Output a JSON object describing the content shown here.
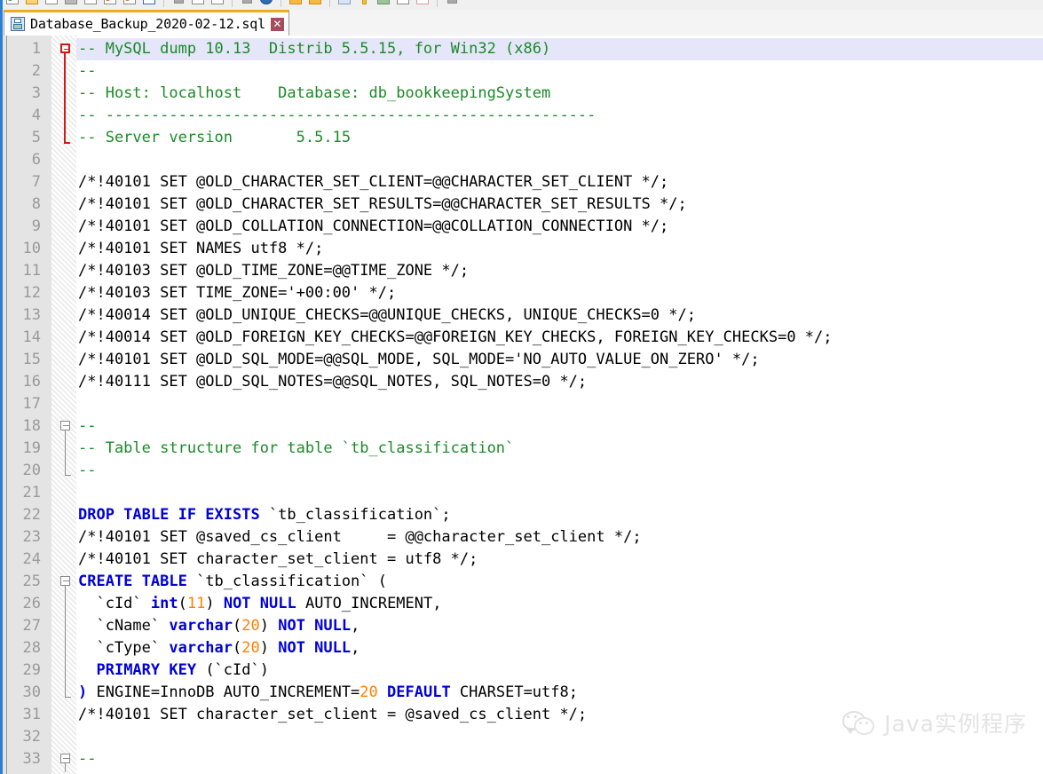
{
  "window": {
    "accent_orange": "#f5a623",
    "frame_blue": "#2a7fd4"
  },
  "toolbar": {
    "name": "main-toolbar",
    "note": "toolbar icon row is clipped at the top edge of the screenshot",
    "buttons": [
      {
        "name": "new-file-icon",
        "kind": "green"
      },
      {
        "name": "open-folder-icon",
        "kind": "folder-open"
      },
      {
        "name": "save-icon",
        "kind": "plain"
      },
      {
        "name": "save-all-icon",
        "kind": "gray"
      },
      {
        "name": "close-file-icon",
        "kind": "plain"
      },
      {
        "name": "close-all-icon",
        "kind": "red"
      },
      {
        "name": "print-icon",
        "kind": "orange"
      },
      {
        "name": "print-now-icon",
        "kind": "blue-sel"
      },
      {
        "sep": true
      },
      {
        "name": "cut-icon",
        "kind": "gray-sm"
      },
      {
        "name": "copy-icon",
        "kind": "plain"
      },
      {
        "name": "paste-icon",
        "kind": "plain"
      },
      {
        "sep": true
      },
      {
        "name": "undo-icon",
        "kind": "gray-sm"
      },
      {
        "name": "redo-icon",
        "kind": "globe"
      },
      {
        "sep": true
      },
      {
        "name": "find-icon",
        "kind": "folder"
      },
      {
        "name": "replace-icon",
        "kind": "folder"
      },
      {
        "sep": true
      },
      {
        "name": "zoom-in-icon",
        "kind": "lightblue"
      },
      {
        "name": "zoom-out-icon",
        "kind": "yellowbar"
      },
      {
        "name": "sync-scroll-icon",
        "kind": "greenfill"
      },
      {
        "name": "word-wrap-icon",
        "kind": "plain"
      },
      {
        "name": "show-symbol-icon",
        "kind": "pink"
      },
      {
        "sep": true
      },
      {
        "name": "macro-record-icon",
        "kind": "gray-sm"
      }
    ]
  },
  "tabbar": {
    "active_tab": {
      "label": "Database_Backup_2020-02-12.sql",
      "icon": "floppy-disk-icon",
      "close_label": "✕",
      "modified": false
    }
  },
  "editor": {
    "language": "SQL",
    "current_line": 1,
    "first_visible_line": 1,
    "last_visible_line": 33,
    "colors": {
      "comment": "#1a8a28",
      "keyword": "#0000d8",
      "number": "#ff8000",
      "plain": "#000000",
      "current_line_bg": "#e6e6fa",
      "gutter_bg": "#e4e4e4",
      "line_number": "#9a9a9a"
    },
    "fold_markers": [
      {
        "line": 1,
        "state": "open",
        "color": "#d31616",
        "span_lines": 5
      },
      {
        "line": 18,
        "state": "open",
        "color": "#8a8a8a",
        "span_lines": 3
      },
      {
        "line": 25,
        "state": "open",
        "color": "#8a8a8a",
        "span_lines": 6
      },
      {
        "line": 33,
        "state": "open",
        "color": "#8a8a8a",
        "span_lines": 1
      }
    ],
    "lines": [
      {
        "n": 1,
        "tokens": [
          {
            "t": "-- MySQL dump 10.13  Distrib 5.5.15, for Win32 (x86)",
            "c": "cm"
          }
        ]
      },
      {
        "n": 2,
        "tokens": [
          {
            "t": "--",
            "c": "cm"
          }
        ]
      },
      {
        "n": 3,
        "tokens": [
          {
            "t": "-- Host: localhost    Database: db_bookkeepingSystem",
            "c": "cm"
          }
        ]
      },
      {
        "n": 4,
        "tokens": [
          {
            "t": "-- ------------------------------------------------------",
            "c": "cm"
          }
        ]
      },
      {
        "n": 5,
        "tokens": [
          {
            "t": "-- Server version\t5.5.15",
            "c": "cm"
          }
        ]
      },
      {
        "n": 6,
        "tokens": []
      },
      {
        "n": 7,
        "tokens": [
          {
            "t": "/*!40101 SET @OLD_CHARACTER_SET_CLIENT=@@CHARACTER_SET_CLIENT */;",
            "c": "pl"
          }
        ]
      },
      {
        "n": 8,
        "tokens": [
          {
            "t": "/*!40101 SET @OLD_CHARACTER_SET_RESULTS=@@CHARACTER_SET_RESULTS */;",
            "c": "pl"
          }
        ]
      },
      {
        "n": 9,
        "tokens": [
          {
            "t": "/*!40101 SET @OLD_COLLATION_CONNECTION=@@COLLATION_CONNECTION */;",
            "c": "pl"
          }
        ]
      },
      {
        "n": 10,
        "tokens": [
          {
            "t": "/*!40101 SET NAMES utf8 */;",
            "c": "pl"
          }
        ]
      },
      {
        "n": 11,
        "tokens": [
          {
            "t": "/*!40103 SET @OLD_TIME_ZONE=@@TIME_ZONE */;",
            "c": "pl"
          }
        ]
      },
      {
        "n": 12,
        "tokens": [
          {
            "t": "/*!40103 SET TIME_ZONE='+00:00' */;",
            "c": "pl"
          }
        ]
      },
      {
        "n": 13,
        "tokens": [
          {
            "t": "/*!40014 SET @OLD_UNIQUE_CHECKS=@@UNIQUE_CHECKS, UNIQUE_CHECKS=0 */;",
            "c": "pl"
          }
        ]
      },
      {
        "n": 14,
        "tokens": [
          {
            "t": "/*!40014 SET @OLD_FOREIGN_KEY_CHECKS=@@FOREIGN_KEY_CHECKS, FOREIGN_KEY_CHECKS=0 */;",
            "c": "pl"
          }
        ]
      },
      {
        "n": 15,
        "tokens": [
          {
            "t": "/*!40101 SET @OLD_SQL_MODE=@@SQL_MODE, SQL_MODE='NO_AUTO_VALUE_ON_ZERO' */;",
            "c": "pl"
          }
        ]
      },
      {
        "n": 16,
        "tokens": [
          {
            "t": "/*!40111 SET @OLD_SQL_NOTES=@@SQL_NOTES, SQL_NOTES=0 */;",
            "c": "pl"
          }
        ]
      },
      {
        "n": 17,
        "tokens": []
      },
      {
        "n": 18,
        "tokens": [
          {
            "t": "--",
            "c": "cm"
          }
        ]
      },
      {
        "n": 19,
        "tokens": [
          {
            "t": "-- Table structure for table `tb_classification`",
            "c": "cm"
          }
        ]
      },
      {
        "n": 20,
        "tokens": [
          {
            "t": "--",
            "c": "cm"
          }
        ]
      },
      {
        "n": 21,
        "tokens": []
      },
      {
        "n": 22,
        "tokens": [
          {
            "t": "DROP TABLE IF EXISTS",
            "c": "kw"
          },
          {
            "t": " `tb_classification`;",
            "c": "pl"
          }
        ]
      },
      {
        "n": 23,
        "tokens": [
          {
            "t": "/*!40101 SET @saved_cs_client     = @@character_set_client */;",
            "c": "pl"
          }
        ]
      },
      {
        "n": 24,
        "tokens": [
          {
            "t": "/*!40101 SET character_set_client = utf8 */;",
            "c": "pl"
          }
        ]
      },
      {
        "n": 25,
        "tokens": [
          {
            "t": "CREATE TABLE",
            "c": "kw"
          },
          {
            "t": " `tb_classification` (",
            "c": "pl"
          }
        ]
      },
      {
        "n": 26,
        "tokens": [
          {
            "t": "  `cId` ",
            "c": "pl"
          },
          {
            "t": "int",
            "c": "kw"
          },
          {
            "t": "(",
            "c": "pl"
          },
          {
            "t": "11",
            "c": "num"
          },
          {
            "t": ") ",
            "c": "pl"
          },
          {
            "t": "NOT NULL",
            "c": "kw"
          },
          {
            "t": " AUTO_INCREMENT,",
            "c": "pl"
          }
        ]
      },
      {
        "n": 27,
        "tokens": [
          {
            "t": "  `cName` ",
            "c": "pl"
          },
          {
            "t": "varchar",
            "c": "kw"
          },
          {
            "t": "(",
            "c": "pl"
          },
          {
            "t": "20",
            "c": "num"
          },
          {
            "t": ") ",
            "c": "pl"
          },
          {
            "t": "NOT NULL",
            "c": "kw"
          },
          {
            "t": ",",
            "c": "pl"
          }
        ]
      },
      {
        "n": 28,
        "tokens": [
          {
            "t": "  `cType` ",
            "c": "pl"
          },
          {
            "t": "varchar",
            "c": "kw"
          },
          {
            "t": "(",
            "c": "pl"
          },
          {
            "t": "20",
            "c": "num"
          },
          {
            "t": ") ",
            "c": "pl"
          },
          {
            "t": "NOT NULL",
            "c": "kw"
          },
          {
            "t": ",",
            "c": "pl"
          }
        ]
      },
      {
        "n": 29,
        "tokens": [
          {
            "t": "  ",
            "c": "pl"
          },
          {
            "t": "PRIMARY KEY",
            "c": "kw"
          },
          {
            "t": " (`cId`)",
            "c": "pl"
          }
        ]
      },
      {
        "n": 30,
        "tokens": [
          {
            "t": ")",
            "c": "kw"
          },
          {
            "t": " ENGINE=InnoDB AUTO_INCREMENT=",
            "c": "pl"
          },
          {
            "t": "20",
            "c": "num"
          },
          {
            "t": " ",
            "c": "pl"
          },
          {
            "t": "DEFAULT",
            "c": "kw"
          },
          {
            "t": " CHARSET=utf8;",
            "c": "pl"
          }
        ]
      },
      {
        "n": 31,
        "tokens": [
          {
            "t": "/*!40101 SET character_set_client = @saved_cs_client */;",
            "c": "pl"
          }
        ]
      },
      {
        "n": 32,
        "tokens": []
      },
      {
        "n": 33,
        "tokens": [
          {
            "t": "--",
            "c": "cm"
          }
        ]
      }
    ]
  },
  "watermark": {
    "icon": "wechat-logo-icon",
    "text": "Java实例程序"
  }
}
